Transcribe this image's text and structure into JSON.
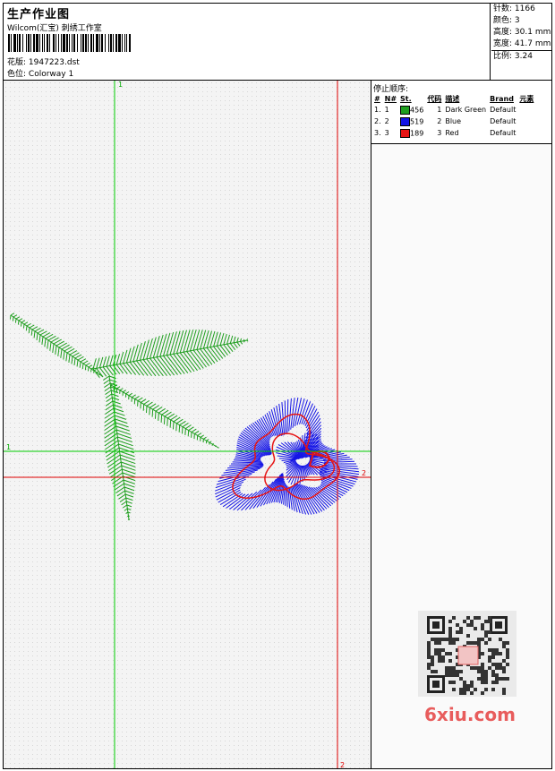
{
  "header": {
    "title": "生产作业图",
    "company": "Wilcom(汇宝) 刺绣工作室",
    "design_label": "花版:",
    "design_value": "1947223.dst",
    "colorway_label": "色位:",
    "colorway_value": "Colorway 1"
  },
  "stats": [
    {
      "label": "针数:",
      "value": "1166"
    },
    {
      "label": "颜色:",
      "value": "3"
    },
    {
      "label": "高度:",
      "value": "30.1 mm"
    },
    {
      "label": "宽度:",
      "value": "41.7 mm"
    },
    {
      "label": "比例:",
      "value": "3.24"
    }
  ],
  "stop_sequence": {
    "title": "停止顺序:",
    "columns": [
      "#",
      "N#",
      "St.",
      "代码",
      "描述",
      "Brand",
      "元素"
    ],
    "rows": [
      {
        "num": "1.",
        "n": "1",
        "st": "456",
        "code": "1",
        "desc": "Dark Green",
        "brand": "Default",
        "color": "#1e9e1e"
      },
      {
        "num": "2.",
        "n": "2",
        "st": "519",
        "code": "2",
        "desc": "Blue",
        "brand": "Default",
        "color": "#1414e6"
      },
      {
        "num": "3.",
        "n": "3",
        "st": "189",
        "code": "3",
        "desc": "Red",
        "brand": "Default",
        "color": "#e61414"
      }
    ]
  },
  "markers": {
    "green_top": "1",
    "green_left": "1",
    "red_right": "2",
    "red_bottom": "2"
  },
  "colors": {
    "green": "#1e9e1e",
    "blue": "#1414e6",
    "red": "#e61414",
    "crosshair_green": "#00cc00",
    "crosshair_red": "#e00000"
  },
  "watermark": {
    "text": "6xiu.com",
    "icon": "qr-code-icon"
  }
}
